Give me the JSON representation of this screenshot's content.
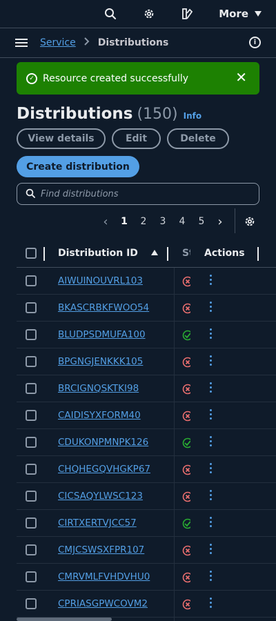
{
  "topbar": {
    "more_label": "More"
  },
  "breadcrumb": {
    "service": "Service",
    "current": "Distributions"
  },
  "flash": {
    "message": "Resource created successfully"
  },
  "header": {
    "title": "Distributions",
    "count": "(150)",
    "info": "Info"
  },
  "actions": {
    "view_details": "View details",
    "edit": "Edit",
    "delete": "Delete",
    "create": "Create distribution"
  },
  "search": {
    "placeholder": "Find distributions"
  },
  "pagination": {
    "pages": [
      "1",
      "2",
      "3",
      "4",
      "5"
    ],
    "current": "1"
  },
  "table": {
    "columns": {
      "id": "Distribution ID",
      "status": "Status",
      "actions": "Actions"
    },
    "rows": [
      {
        "id": "AIWUINOUVRL103",
        "status": "error"
      },
      {
        "id": "BKASCRBKFWOO54",
        "status": "error"
      },
      {
        "id": "BLUDPSDMUFA100",
        "status": "success"
      },
      {
        "id": "BPGNGJENKKK105",
        "status": "error"
      },
      {
        "id": "BRCIGNQSKTKI98",
        "status": "error"
      },
      {
        "id": "CAIDISYXFORM40",
        "status": "error"
      },
      {
        "id": "CDUKONPMNPK126",
        "status": "success"
      },
      {
        "id": "CHQHEGQVHGKP67",
        "status": "error"
      },
      {
        "id": "CICSAQYLWSC123",
        "status": "error"
      },
      {
        "id": "CIRTXERTVJCC57",
        "status": "success"
      },
      {
        "id": "CMJCSWSXFPR107",
        "status": "error"
      },
      {
        "id": "CMRVMLFVHDVHU0",
        "status": "error"
      },
      {
        "id": "CPRIASGPWCOVM2",
        "status": "error"
      }
    ]
  },
  "colors": {
    "background": "#0f1b2a",
    "link": "#539fe5",
    "success": "#1d8102",
    "error": "#eb6f6f",
    "ok": "#29ad32"
  },
  "icons": [
    "search-icon",
    "gear-icon",
    "theme-icon",
    "caret-down-icon",
    "menu-icon",
    "info-icon",
    "check-circle-icon",
    "close-icon",
    "sort-ascending-icon",
    "status-error-icon",
    "status-success-icon",
    "more-vertical-icon"
  ]
}
